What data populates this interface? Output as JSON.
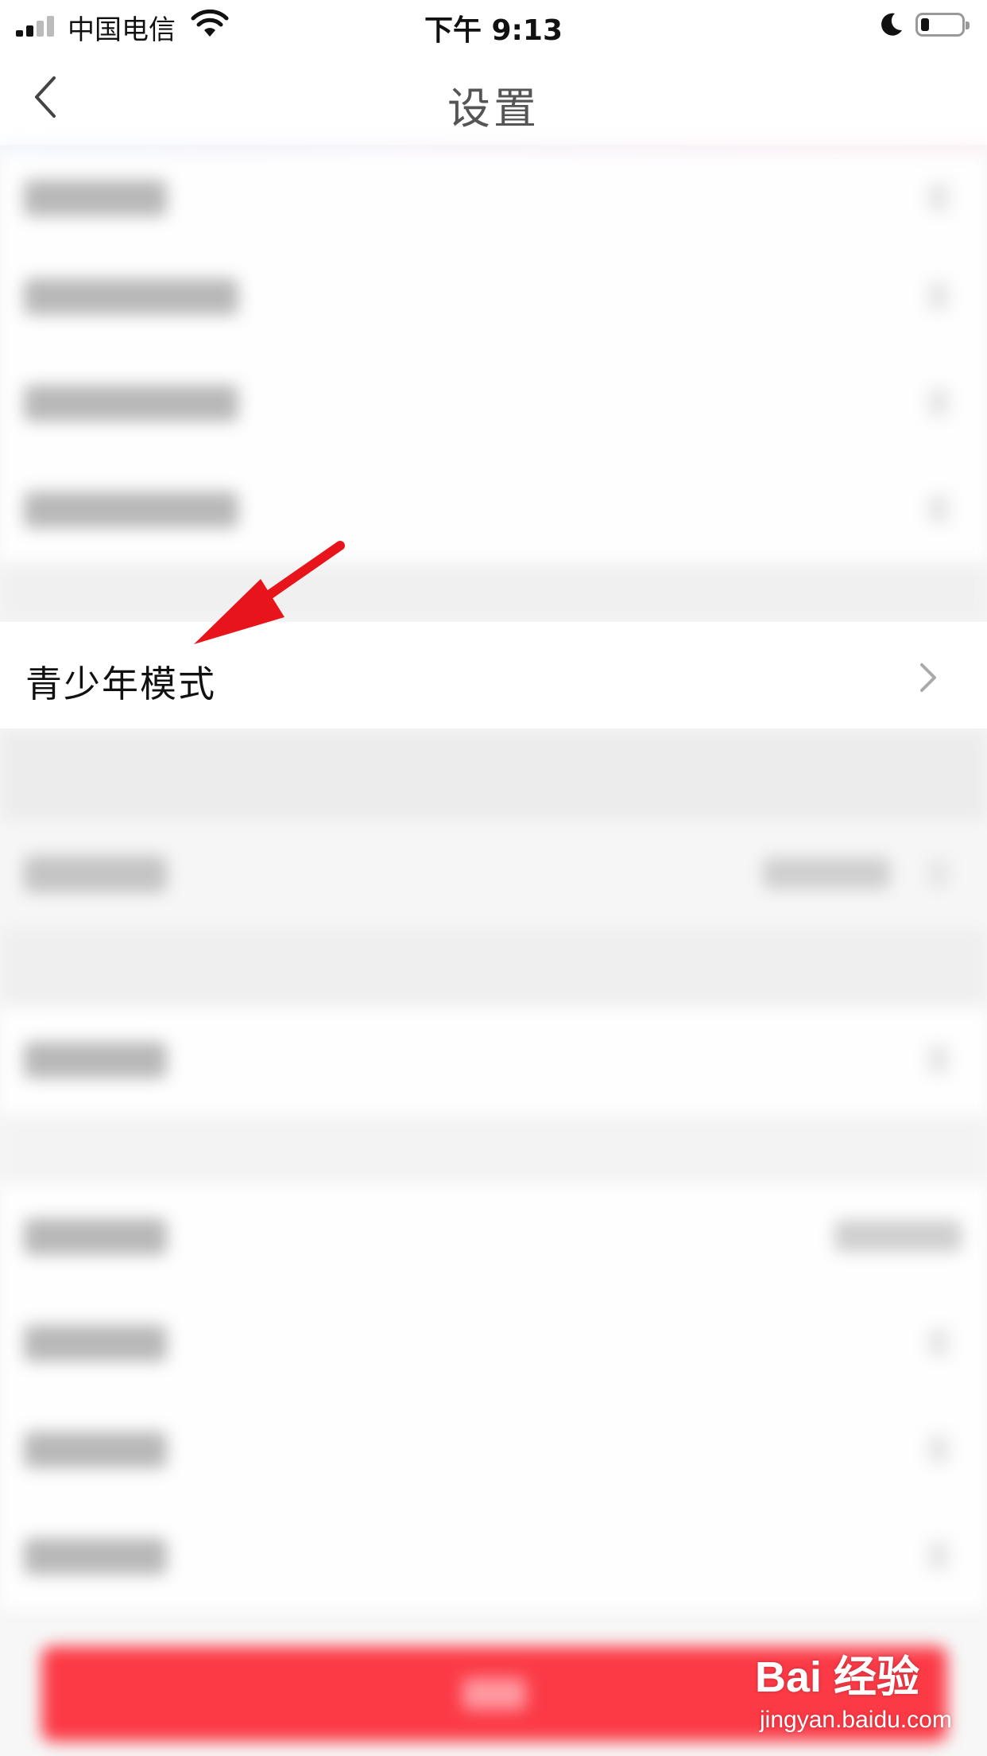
{
  "status_bar": {
    "carrier": "中国电信",
    "time": "下午 9:13",
    "battery_level": 0.2,
    "icons": [
      "signal-icon",
      "wifi-icon",
      "moon-icon",
      "battery-icon"
    ]
  },
  "nav": {
    "title": "设置",
    "back_icon": "chevron-left-icon"
  },
  "teen_mode_row": {
    "label": "青少年模式",
    "chevron_icon": "chevron-right-icon"
  },
  "annotation": {
    "arrow_icon": "red-arrow-icon",
    "color": "#e8141c"
  },
  "logout_button": {
    "color": "#fb3a46"
  },
  "watermark": {
    "logo": "Bai 经验",
    "site": "jingyan.baidu.com"
  },
  "colors": {
    "accent": "#fb3a46",
    "background": "#f7f7f7"
  }
}
